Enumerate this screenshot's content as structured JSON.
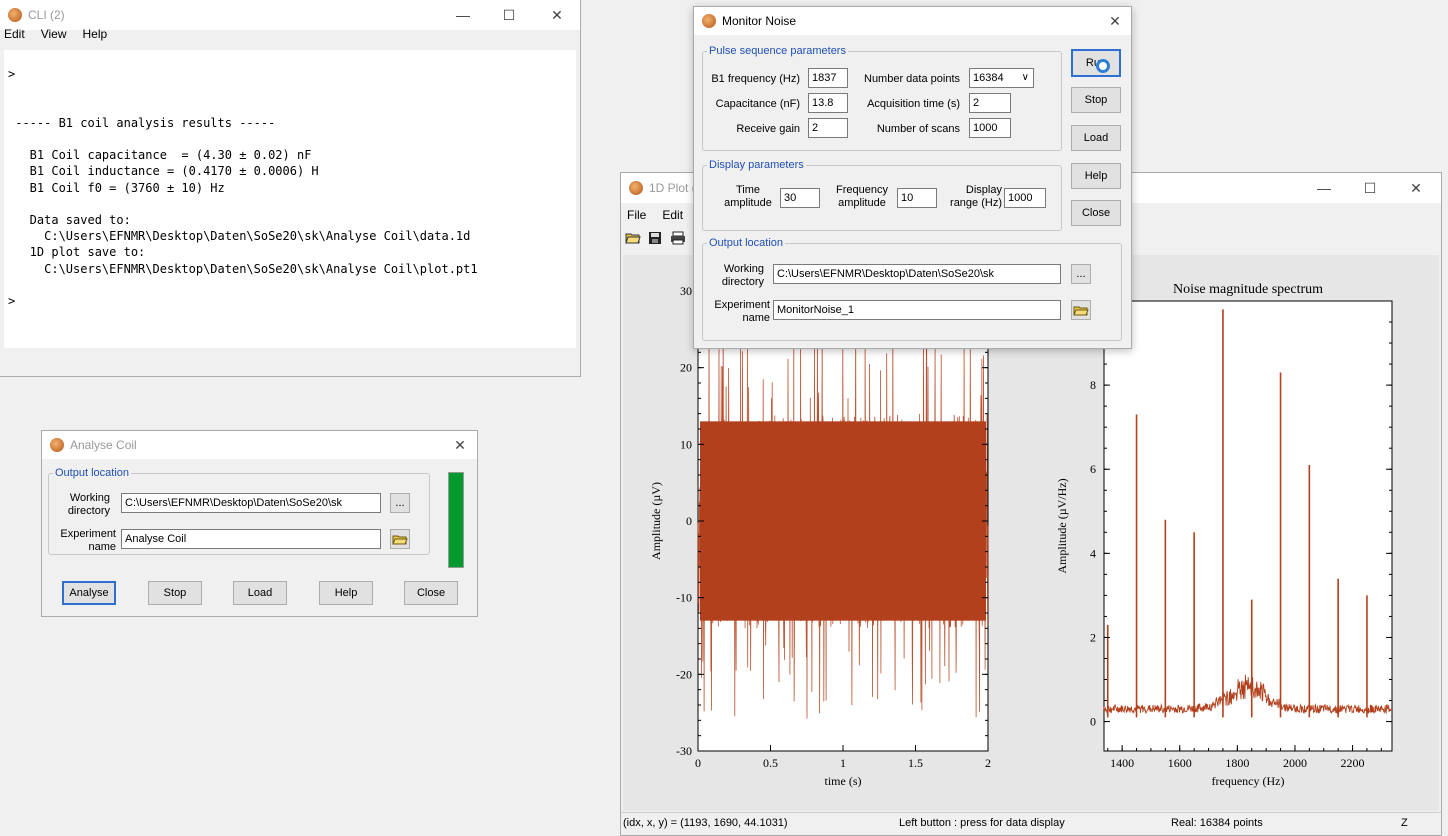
{
  "cli": {
    "title": "CLI (2)",
    "menu": [
      "Edit",
      "View",
      "Help"
    ],
    "lines": [
      "",
      ">",
      "",
      "",
      " ----- B1 coil analysis results -----",
      "",
      "   B1 Coil capacitance  = (4.30 ± 0.02) nF",
      "   B1 Coil inductance = (0.4170 ± 0.0006) H",
      "   B1 Coil f0 = (3760 ± 10) Hz",
      "",
      "   Data saved to:",
      "     C:\\Users\\EFNMR\\Desktop\\Daten\\SoSe20\\sk\\Analyse Coil\\data.1d",
      "   1D plot save to:",
      "     C:\\Users\\EFNMR\\Desktop\\Daten\\SoSe20\\sk\\Analyse Coil\\plot.pt1",
      "",
      ">"
    ]
  },
  "analyse": {
    "title": "Analyse Coil",
    "group": "Output location",
    "working_label": "Working directory",
    "working_value": "C:\\Users\\EFNMR\\Desktop\\Daten\\SoSe20\\sk",
    "browse": "...",
    "experiment_label": "Experiment name",
    "experiment_value": "Analyse Coil",
    "buttons": [
      "Analyse",
      "Stop",
      "Load",
      "Help",
      "Close"
    ],
    "indicator_color": "#009a2e"
  },
  "monitor": {
    "title": "Monitor Noise",
    "pulse_group": "Pulse sequence parameters",
    "b1_label": "B1 frequency (Hz)",
    "b1_value": "1837",
    "cap_label": "Capacitance (nF)",
    "cap_value": "13.8",
    "gain_label": "Receive gain",
    "gain_value": "2",
    "ndp_label": "Number data points",
    "ndp_value": "16384",
    "acq_label": "Acquisition time (s)",
    "acq_value": "2",
    "scans_label": "Number of scans",
    "scans_value": "1000",
    "display_group": "Display parameters",
    "time_amp_label": "Time amplitude",
    "time_amp_value": "30",
    "freq_amp_label": "Frequency amplitude",
    "freq_amp_value": "10",
    "disp_range_label": "Display range (Hz)",
    "disp_range_value": "1000",
    "output_group": "Output location",
    "working_label": "Working directory",
    "working_value": "C:\\Users\\EFNMR\\Desktop\\Daten\\SoSe20\\sk",
    "browse": "...",
    "experiment_label": "Experiment name",
    "experiment_value": "MonitorNoise_1",
    "buttons": [
      "Run",
      "Stop",
      "Load",
      "Help",
      "Close"
    ]
  },
  "plot": {
    "title": "1D Plot (",
    "menu": [
      "File",
      "Edit"
    ],
    "status_coords": "(idx, x, y) = (1193, 1690,  44.1031)",
    "status_hint": "Left button : press for data display",
    "status_real": "Real: 16384 points",
    "status_z": "Z"
  },
  "chart_data": [
    {
      "type": "line",
      "title": "",
      "xlabel": "time (s)",
      "ylabel": "Amplitude (µV)",
      "xlim": [
        0,
        2
      ],
      "ylim": [
        -30,
        30
      ],
      "xticks": [
        "0",
        "0.5",
        "1",
        "1.5",
        "2"
      ],
      "yticks": [
        "-30",
        "-20",
        "-10",
        "0",
        "10",
        "20",
        "30"
      ],
      "series": [
        {
          "color": "#b3401c",
          "description": "dense noise approx. ±15 µV with spikes up to ±25 µV",
          "values": [
            0,
            14,
            -13,
            22,
            -19,
            12,
            -25,
            15,
            -12,
            20,
            -14,
            13,
            -21,
            11,
            -15,
            24,
            -13,
            14,
            -18,
            12
          ]
        }
      ]
    },
    {
      "type": "line",
      "title": "Noise magnitude spectrum",
      "xlabel": "frequency (Hz)",
      "ylabel": "Amplitude (µV/Hz)",
      "xlim": [
        1337,
        2337
      ],
      "ylim": [
        -0.7,
        10
      ],
      "xticks": [
        "1400",
        "1600",
        "1800",
        "2000",
        "2200"
      ],
      "yticks": [
        "0",
        "2",
        "4",
        "6",
        "8"
      ],
      "series": [
        {
          "color": "#b3401c",
          "peaks_x": [
            1350,
            1450,
            1550,
            1650,
            1750,
            1850,
            1950,
            2050,
            2150,
            2250
          ],
          "peaks_y": [
            2.3,
            7.3,
            4.8,
            4.5,
            9.8,
            2.9,
            8.3,
            6.1,
            3.4,
            3.0
          ],
          "baseline": 0.2
        }
      ]
    }
  ]
}
